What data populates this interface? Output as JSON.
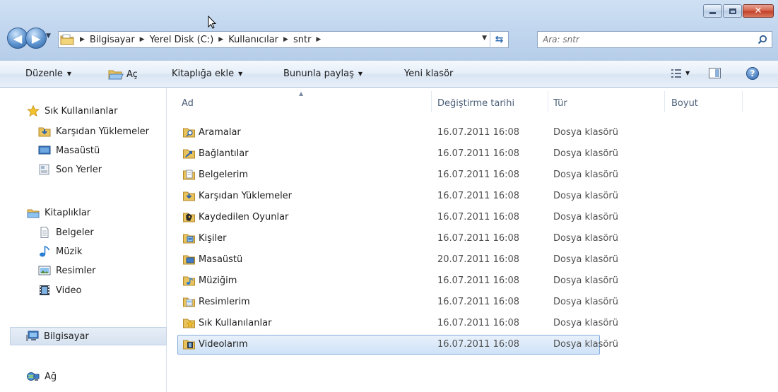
{
  "window": {
    "caption_buttons": {
      "minimize": "minimize",
      "maximize": "maximize",
      "close": "✕"
    }
  },
  "address_bar": {
    "crumbs": [
      "Bilgisayar",
      "Yerel Disk (C:)",
      "Kullanıcılar",
      "sntr"
    ]
  },
  "search": {
    "placeholder": "Ara: sntr"
  },
  "toolbar": {
    "organize": "Düzenle",
    "open": "Aç",
    "add_to_library": "Kitaplığa ekle",
    "share_with": "Bununla paylaş",
    "new_folder": "Yeni klasör"
  },
  "nav_pane": {
    "favorites": "Sık Kullanılanlar",
    "favorites_items": [
      "Karşıdan Yüklemeler",
      "Masaüstü",
      "Son Yerler"
    ],
    "libraries": "Kitaplıklar",
    "libraries_items": [
      "Belgeler",
      "Müzik",
      "Resimler",
      "Video"
    ],
    "computer": "Bilgisayar",
    "network": "Ağ"
  },
  "columns": {
    "name": "Ad",
    "modified": "Değiştirme tarihi",
    "type": "Tür",
    "size": "Boyut"
  },
  "files": [
    {
      "name": "Aramalar",
      "modified": "16.07.2011 16:08",
      "type": "Dosya klasörü"
    },
    {
      "name": "Bağlantılar",
      "modified": "16.07.2011 16:08",
      "type": "Dosya klasörü"
    },
    {
      "name": "Belgelerim",
      "modified": "16.07.2011 16:08",
      "type": "Dosya klasörü"
    },
    {
      "name": "Karşıdan Yüklemeler",
      "modified": "16.07.2011 16:08",
      "type": "Dosya klasörü"
    },
    {
      "name": "Kaydedilen Oyunlar",
      "modified": "16.07.2011 16:08",
      "type": "Dosya klasörü"
    },
    {
      "name": "Kişiler",
      "modified": "16.07.2011 16:08",
      "type": "Dosya klasörü"
    },
    {
      "name": "Masaüstü",
      "modified": "20.07.2011 16:08",
      "type": "Dosya klasörü"
    },
    {
      "name": "Müziğim",
      "modified": "16.07.2011 16:08",
      "type": "Dosya klasörü"
    },
    {
      "name": "Resimlerim",
      "modified": "16.07.2011 16:08",
      "type": "Dosya klasörü"
    },
    {
      "name": "Sık Kullanılanlar",
      "modified": "16.07.2011 16:08",
      "type": "Dosya klasörü"
    },
    {
      "name": "Videolarım",
      "modified": "16.07.2011 16:08",
      "type": "Dosya klasörü"
    }
  ],
  "selected_file": "Videolarım",
  "colors": {
    "folder": "#e8c25c",
    "selection_border": "#84acdd",
    "selection_fill": "#d9e8f8",
    "chrome": "#c2d7ef"
  }
}
